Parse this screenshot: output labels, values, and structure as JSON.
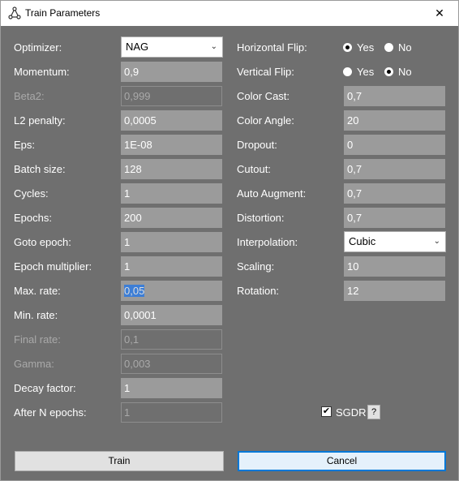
{
  "window": {
    "title": "Train Parameters",
    "close_symbol": "✕"
  },
  "left": {
    "optimizer": {
      "label": "Optimizer:",
      "value": "NAG"
    },
    "momentum": {
      "label": "Momentum:",
      "value": "0,9"
    },
    "beta2": {
      "label": "Beta2:",
      "value": "0,999"
    },
    "l2": {
      "label": "L2 penalty:",
      "value": "0,0005"
    },
    "eps": {
      "label": "Eps:",
      "value": "1E-08"
    },
    "batch": {
      "label": "Batch size:",
      "value": "128"
    },
    "cycles": {
      "label": "Cycles:",
      "value": "1"
    },
    "epochs": {
      "label": "Epochs:",
      "value": "200"
    },
    "goto": {
      "label": "Goto epoch:",
      "value": "1"
    },
    "multiplier": {
      "label": "Epoch multiplier:",
      "value": "1"
    },
    "maxrate": {
      "label": "Max. rate:",
      "value": "0,05"
    },
    "minrate": {
      "label": "Min. rate:",
      "value": "0,0001"
    },
    "finalrate": {
      "label": "Final rate:",
      "value": "0,1"
    },
    "gamma": {
      "label": "Gamma:",
      "value": "0,003"
    },
    "decay": {
      "label": "Decay factor:",
      "value": "1"
    },
    "aftern": {
      "label": "After N epochs:",
      "value": "1"
    }
  },
  "right": {
    "hflip": {
      "label": "Horizontal Flip:",
      "yes": "Yes",
      "no": "No",
      "selected": "Yes"
    },
    "vflip": {
      "label": "Vertical Flip:",
      "yes": "Yes",
      "no": "No",
      "selected": "No"
    },
    "colorcast": {
      "label": "Color Cast:",
      "value": "0,7"
    },
    "colorangle": {
      "label": "Color Angle:",
      "value": "20"
    },
    "dropout": {
      "label": "Dropout:",
      "value": "0"
    },
    "cutout": {
      "label": "Cutout:",
      "value": "0,7"
    },
    "autoaugment": {
      "label": "Auto Augment:",
      "value": "0,7"
    },
    "distortion": {
      "label": "Distortion:",
      "value": "0,7"
    },
    "interpolation": {
      "label": "Interpolation:",
      "value": "Cubic"
    },
    "scaling": {
      "label": "Scaling:",
      "value": "10"
    },
    "rotation": {
      "label": "Rotation:",
      "value": "12"
    }
  },
  "sgdr": {
    "label": "SGDR",
    "checked": true,
    "check_symbol": "✔",
    "help": "?"
  },
  "buttons": {
    "train": "Train",
    "cancel": "Cancel"
  },
  "colors": {
    "background": "#6f6f6f",
    "field": "#9b9b9b",
    "accent": "#0078d7"
  }
}
